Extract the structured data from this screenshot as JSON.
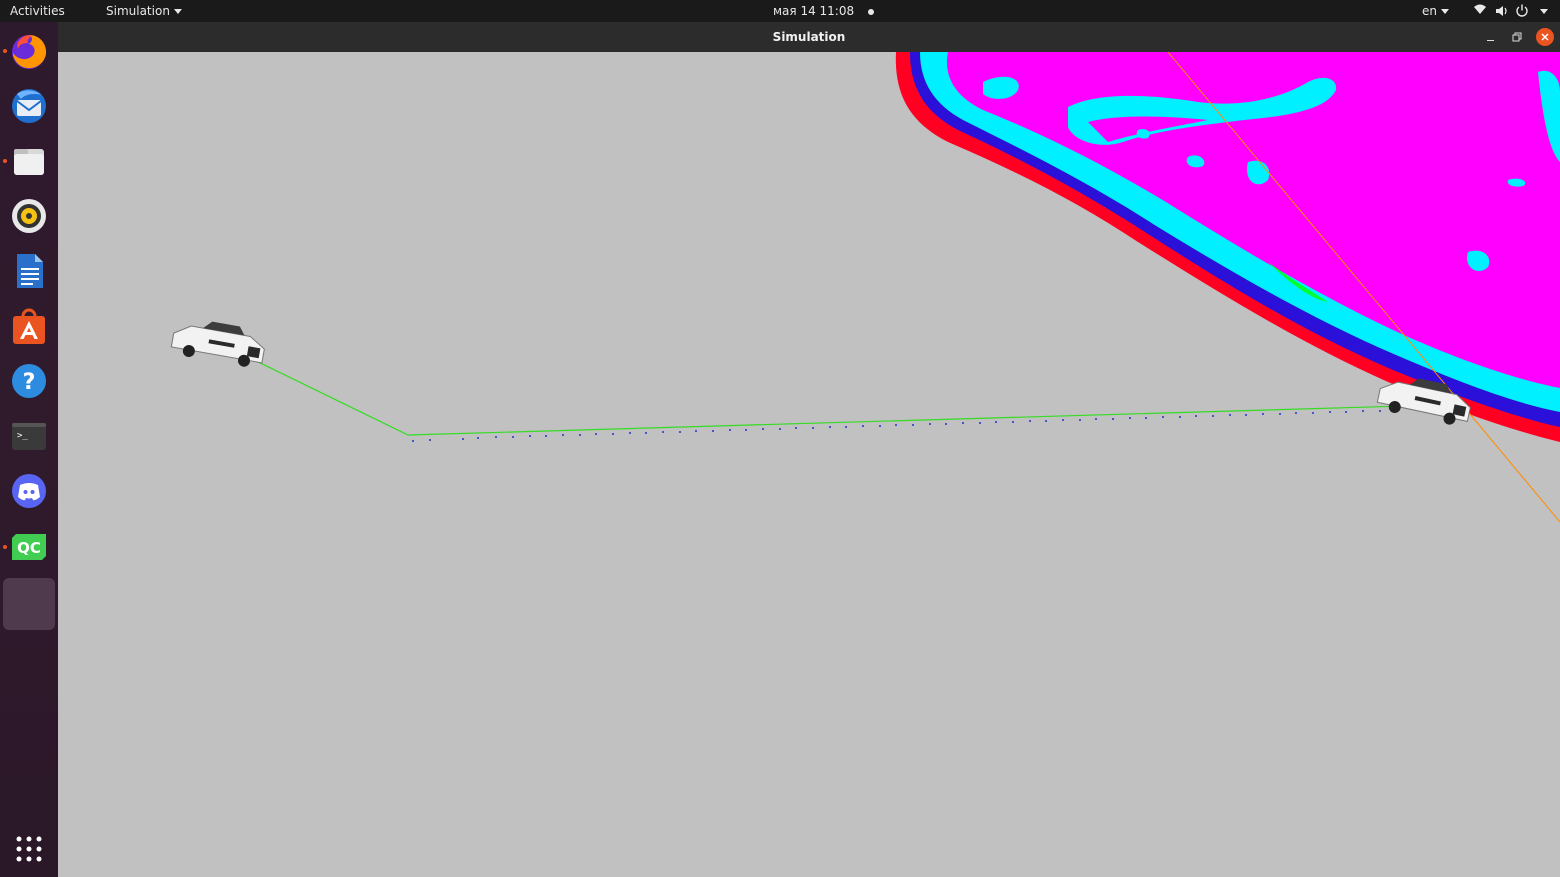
{
  "topbar": {
    "activities_label": "Activities",
    "app_menu_label": "Simulation",
    "datetime": "мая 14  11:08",
    "language": "en"
  },
  "window": {
    "title": "Simulation"
  },
  "dock": {
    "items": [
      {
        "name": "firefox",
        "icon": "firefox-icon",
        "running": true
      },
      {
        "name": "thunderbird",
        "icon": "thunderbird-icon",
        "running": false
      },
      {
        "name": "files",
        "icon": "folder-icon",
        "running": true
      },
      {
        "name": "rhythmbox",
        "icon": "speaker-icon",
        "running": false
      },
      {
        "name": "libreoffice-writer",
        "icon": "document-icon",
        "running": false
      },
      {
        "name": "ubuntu-software",
        "icon": "software-store-icon",
        "running": false
      },
      {
        "name": "help",
        "icon": "help-icon",
        "running": false
      },
      {
        "name": "terminal",
        "icon": "terminal-icon",
        "running": false
      },
      {
        "name": "discord",
        "icon": "discord-icon",
        "running": false
      },
      {
        "name": "qt-creator",
        "icon": "qtcreator-icon",
        "running": true
      },
      {
        "name": "simulation-window",
        "icon": "blank-app-icon",
        "running": true,
        "active": true
      }
    ],
    "show_apps_icon": "app-grid-icon"
  },
  "colors": {
    "viewport_bg": "#c1c1c1",
    "path_line": "#33dd22",
    "path_dots": "#2233cc",
    "ray_line": "#ff8c00",
    "costmap": [
      "#ff00ff",
      "#00ffff",
      "#0000ff",
      "#ff0000",
      "#00ff00"
    ],
    "accent": "#e95420"
  }
}
